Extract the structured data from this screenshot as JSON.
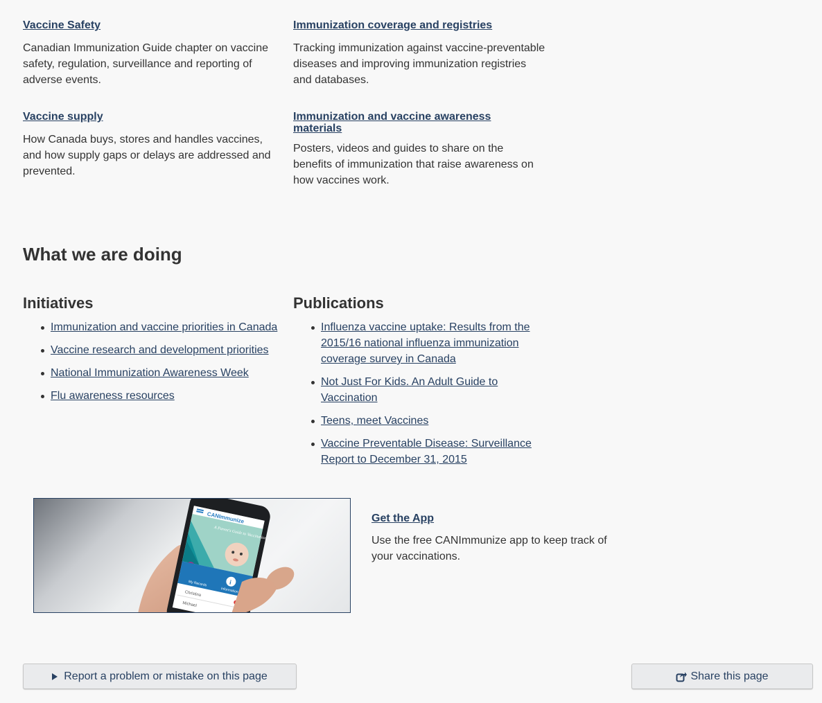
{
  "topics": [
    {
      "title": "Vaccine Safety",
      "desc": "Canadian Immunization Guide chapter on vaccine safety, regulation, surveillance and reporting of adverse events."
    },
    {
      "title": "Immunization coverage and registries",
      "desc": "Tracking immunization against vaccine-preventable diseases and improving immunization registries and databases."
    },
    {
      "title": "Vaccine supply",
      "desc": "How Canada buys, stores and handles vaccines, and how supply gaps or delays are addressed and prevented."
    },
    {
      "title": "Immunization and vaccine awareness materials",
      "desc": "Posters, videos and guides to share on the benefits of immunization that raise awareness on how vaccines work."
    }
  ],
  "section_title": "What we are doing",
  "initiatives": {
    "heading": "Initiatives",
    "items": [
      "Immunization and vaccine priorities in Canada",
      "Vaccine research and development priorities",
      "National Immunization Awareness Week",
      "Flu awareness resources"
    ]
  },
  "publications": {
    "heading": "Publications",
    "items": [
      "Influenza vaccine uptake: Results from the 2015/16 national influenza immunization coverage survey in Canada",
      "Not Just For Kids. An Adult Guide to Vaccination",
      "Teens, meet Vaccines",
      "Vaccine Preventable Disease: Surveillance Report to December 31, 2015"
    ]
  },
  "app_promo": {
    "title": "Get the App",
    "desc": "Use the free CANImmunize app to keep track of your vaccinations.",
    "image_text": {
      "logo": "CANImmunize",
      "guide": "A Parent's Guide to Vaccination",
      "my_records": "My Records",
      "information": "Information",
      "name1": "Christina",
      "name2": "Michael"
    }
  },
  "footer": {
    "report_label": "Report a problem or mistake on this page",
    "share_label": "Share this page"
  },
  "colors": {
    "link": "#284162",
    "text": "#333333",
    "background": "#f8f8f8",
    "button_bg": "#eaebed"
  }
}
